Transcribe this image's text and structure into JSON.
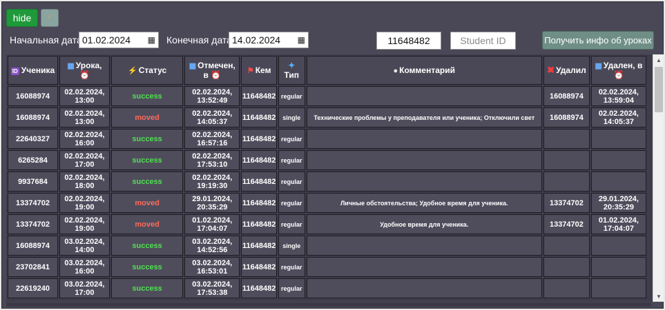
{
  "controls": {
    "hide_label": "hide",
    "broom_icon": "broom-icon"
  },
  "filters": {
    "start_label": "Начальная дата",
    "start_value": "01.02.2024",
    "end_label": "Конечная дата",
    "end_value": "14.02.2024",
    "teacher_id_value": "11648482",
    "student_id_placeholder": "Student ID",
    "get_button_label": "Получить инфо об уроках"
  },
  "table": {
    "headers": {
      "student": "Ученика",
      "lesson_a": "Урока,",
      "status": "Статус",
      "cancelled_a": "Отмечен,",
      "cancelled_b": "в",
      "by_whom": "Кем",
      "type": "Тип",
      "comment": "Комментарий",
      "deleted_by": "Удалил",
      "deleted_at": "Удален, в"
    },
    "rows": [
      {
        "student": "16088974",
        "lesson_d": "02.02.2024,",
        "lesson_t": "13:00",
        "status": "success",
        "marked_d": "02.02.2024,",
        "marked_t": "13:52:49",
        "by": "11648482",
        "type": "regular",
        "comment": "",
        "deleted_by": "16088974",
        "deleted_d": "02.02.2024,",
        "deleted_t": "13:59:04"
      },
      {
        "student": "16088974",
        "lesson_d": "02.02.2024,",
        "lesson_t": "13:00",
        "status": "moved",
        "marked_d": "02.02.2024,",
        "marked_t": "14:05:37",
        "by": "11648482",
        "type": "single",
        "comment": "Технические проблемы у преподавателя или ученика; Отключили свет",
        "deleted_by": "16088974",
        "deleted_d": "02.02.2024,",
        "deleted_t": "14:05:37"
      },
      {
        "student": "22640327",
        "lesson_d": "02.02.2024,",
        "lesson_t": "16:00",
        "status": "success",
        "marked_d": "02.02.2024,",
        "marked_t": "16:57:16",
        "by": "11648482",
        "type": "regular",
        "comment": "",
        "deleted_by": "",
        "deleted_d": "",
        "deleted_t": ""
      },
      {
        "student": "6265284",
        "lesson_d": "02.02.2024,",
        "lesson_t": "17:00",
        "status": "success",
        "marked_d": "02.02.2024,",
        "marked_t": "17:53:10",
        "by": "11648482",
        "type": "regular",
        "comment": "",
        "deleted_by": "",
        "deleted_d": "",
        "deleted_t": ""
      },
      {
        "student": "9937684",
        "lesson_d": "02.02.2024,",
        "lesson_t": "18:00",
        "status": "success",
        "marked_d": "02.02.2024,",
        "marked_t": "19:19:30",
        "by": "11648482",
        "type": "regular",
        "comment": "",
        "deleted_by": "",
        "deleted_d": "",
        "deleted_t": ""
      },
      {
        "student": "13374702",
        "lesson_d": "02.02.2024,",
        "lesson_t": "19:00",
        "status": "moved",
        "marked_d": "29.01.2024,",
        "marked_t": "20:35:29",
        "by": "11648482",
        "type": "regular",
        "comment": "Личные обстоятельства; Удобное время для ученика.",
        "deleted_by": "13374702",
        "deleted_d": "29.01.2024,",
        "deleted_t": "20:35:29"
      },
      {
        "student": "13374702",
        "lesson_d": "02.02.2024,",
        "lesson_t": "19:00",
        "status": "moved",
        "marked_d": "01.02.2024,",
        "marked_t": "17:04:07",
        "by": "11648482",
        "type": "regular",
        "comment": "Удобное время для ученика.",
        "deleted_by": "13374702",
        "deleted_d": "01.02.2024,",
        "deleted_t": "17:04:07"
      },
      {
        "student": "16088974",
        "lesson_d": "03.02.2024,",
        "lesson_t": "14:00",
        "status": "success",
        "marked_d": "03.02.2024,",
        "marked_t": "14:52:56",
        "by": "11648482",
        "type": "single",
        "comment": "",
        "deleted_by": "",
        "deleted_d": "",
        "deleted_t": ""
      },
      {
        "student": "23702841",
        "lesson_d": "03.02.2024,",
        "lesson_t": "16:00",
        "status": "success",
        "marked_d": "03.02.2024,",
        "marked_t": "16:53:01",
        "by": "11648482",
        "type": "regular",
        "comment": "",
        "deleted_by": "",
        "deleted_d": "",
        "deleted_t": ""
      },
      {
        "student": "22619240",
        "lesson_d": "03.02.2024,",
        "lesson_t": "17:00",
        "status": "success",
        "marked_d": "03.02.2024,",
        "marked_t": "17:53:38",
        "by": "11648482",
        "type": "regular",
        "comment": "",
        "deleted_by": "",
        "deleted_d": "",
        "deleted_t": ""
      }
    ]
  },
  "colors": {
    "success": "#4fe04f",
    "moved": "#ff6a5a",
    "panel_bg": "#4a4857",
    "hide_button": "#1f9a3a"
  }
}
